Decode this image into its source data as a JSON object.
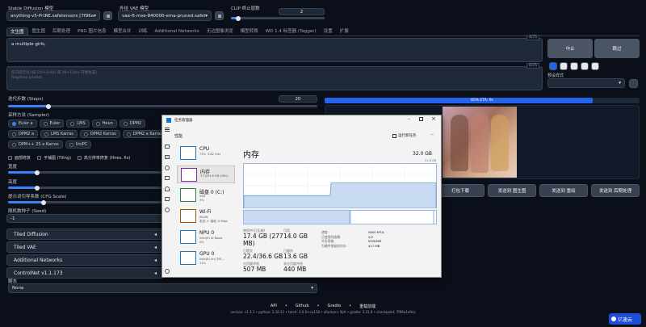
{
  "top": {
    "sd_label": "Stable Diffusion 模型",
    "sd_value": "anything-v5-PrtRE.safetensors [7f96a1a9ca]",
    "vae_label": "外挂 VAE 模型",
    "vae_value": "vae-ft-mse-840000-ema-pruned.safetensors",
    "clip_label": "CLIP 终止层数",
    "clip_value": "2",
    "clip_level": 0.08
  },
  "tabs": [
    "文生图",
    "图生图",
    "后期处理",
    "PNG 图片信息",
    "模型合并",
    "训练",
    "Additional Networks",
    "无边图像浏览",
    "模型转换",
    "WD 1.4 标签器 (Tagger)",
    "设置",
    "扩展"
  ],
  "prompt": {
    "text": "a multiple girls,",
    "counter": "4/75"
  },
  "neg": {
    "placeholder": "反向提示词 (按 Ctrl+Enter 或 Alt+Enter 开始生成)",
    "placeholder2": "Negative prompt",
    "counter": "0/75"
  },
  "gen": {
    "interrupt": "中止",
    "skip": "跳过"
  },
  "styles": {
    "label": "预设样式"
  },
  "steps": {
    "label": "迭代步数 (Steps)",
    "value": "20",
    "level": 0.13
  },
  "sampler": {
    "label": "采样方法 (Sampler)",
    "options": [
      "Euler a",
      "Euler",
      "LMS",
      "Heun",
      "DPM2",
      "DPM2 a",
      "LMS Karras",
      "DPM2 Karras",
      "DPM2 a Karras",
      "DPM++ 2S a Karras",
      "UniPC"
    ],
    "selected": "Euler a"
  },
  "checks": [
    "面部修复",
    "平铺图 (Tiling)",
    "高分辨率修复 (Hires. fix)"
  ],
  "width": {
    "label": "宽度",
    "level": 0.19
  },
  "height": {
    "label": "高度",
    "level": 0.19
  },
  "cfg": {
    "label": "提示词引导系数 (CFG Scale)",
    "level": 0.23
  },
  "seed": {
    "label": "随机数种子 (Seed)",
    "value": "-1"
  },
  "accordions": [
    "Tiled Diffusion",
    "Tiled VAE",
    "Additional Networks",
    "ControlNet v1.1.173"
  ],
  "script": {
    "label": "脚本",
    "value": "None"
  },
  "progress": {
    "text": "85% ETA: 9s",
    "fraction": 0.85
  },
  "actions": [
    "打包下载",
    "发送到 图生图",
    "发送到 重绘",
    "发送到 后期处理"
  ],
  "footer": {
    "links": [
      "API",
      "Github",
      "Gradio",
      "重载前端"
    ],
    "versions": "version: v1.3.1  •  python: 3.10.11  •  torch: 2.0.0+cu118  •  xformers: N/A  •  gradio: 3.31.0  •  checkpoint: 7f96a1a9ca",
    "watermark": "亿速云"
  },
  "taskmgr": {
    "title": "任务管理器",
    "section": "性能",
    "run_task": "运行新任务",
    "header": "内存",
    "total": "32.0 GB",
    "graph_max": "31.6 GB",
    "mem_level": 0.56,
    "sidebar": [
      {
        "name": "CPU",
        "sub": "73%  3.82 GHz",
        "color": "#1a75c7"
      },
      {
        "name": "内存",
        "sub": "17.4/31.6 GB (56%)",
        "color": "#7b2aa3"
      },
      {
        "name": "磁盘 0 (C:)",
        "sub": "SSD\n3%",
        "color": "#1f8a3e"
      },
      {
        "name": "Wi-Fi",
        "sub": "WLAN\n发送: 0  接收: 0 Kbps",
        "color": "#a05a00"
      },
      {
        "name": "NPU 0",
        "sub": "Intel(R) AI Boost\n0%",
        "color": "#1a75c7"
      },
      {
        "name": "GPU 0",
        "sub": "Intel(R) Arc(TM)...\n11%",
        "color": "#1a75c7"
      }
    ],
    "stats": [
      {
        "label": "使用中(已压缩)",
        "value": "17.4 GB (277 MB)"
      },
      {
        "label": "可用",
        "value": "14.0 GB"
      },
      {
        "label": "已提交",
        "value": "22.4/36.6 GB"
      },
      {
        "label": "已缓存",
        "value": "13.6 GB"
      },
      {
        "label": "分页缓冲池",
        "value": "507 MB"
      },
      {
        "label": "非分页缓冲池",
        "value": "440 MB"
      }
    ],
    "right_stats": [
      {
        "label": "速度:",
        "value": "5600 MT/s"
      },
      {
        "label": "已使用的插槽:",
        "value": "2/2"
      },
      {
        "label": "外形规格:",
        "value": "SODIMM"
      },
      {
        "label": "为硬件保留的内存:",
        "value": "417 MB"
      }
    ]
  }
}
